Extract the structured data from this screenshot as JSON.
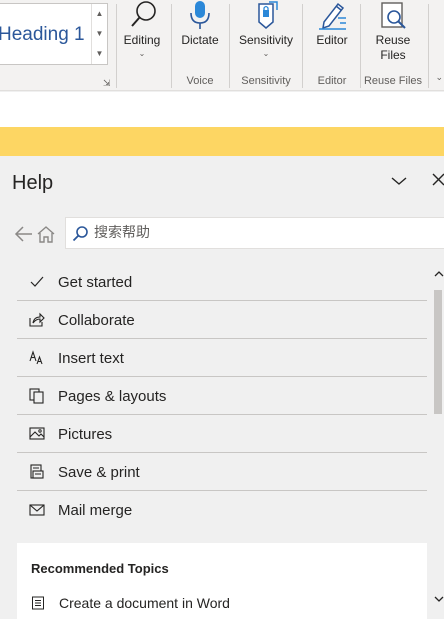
{
  "ribbon": {
    "style_gallery": {
      "current_style": "Heading 1"
    },
    "buttons": {
      "editing": "Editing",
      "dictate": "Dictate",
      "sensitivity": "Sensitivity",
      "editor": "Editor",
      "reuse_files_line1": "Reuse",
      "reuse_files_line2": "Files"
    },
    "groups": {
      "voice": "Voice",
      "sensitivity": "Sensitivity",
      "editor": "Editor",
      "reuse_files": "Reuse Files"
    },
    "accent_color": "#2b579a"
  },
  "notification_bar": {
    "color": "#fdd663"
  },
  "help_pane": {
    "title": "Help",
    "search": {
      "placeholder": "搜索帮助",
      "value": ""
    },
    "topics": [
      {
        "label": "Get started",
        "icon": "checkmark-icon"
      },
      {
        "label": "Collaborate",
        "icon": "share-icon"
      },
      {
        "label": "Insert text",
        "icon": "text-size-icon"
      },
      {
        "label": "Pages & layouts",
        "icon": "pages-icon"
      },
      {
        "label": "Pictures",
        "icon": "picture-icon"
      },
      {
        "label": "Save & print",
        "icon": "save-print-icon"
      },
      {
        "label": "Mail merge",
        "icon": "mail-icon"
      }
    ],
    "recommended": {
      "title": "Recommended Topics",
      "items": [
        {
          "label": "Create a document in Word",
          "icon": "document-list-icon"
        }
      ]
    }
  }
}
